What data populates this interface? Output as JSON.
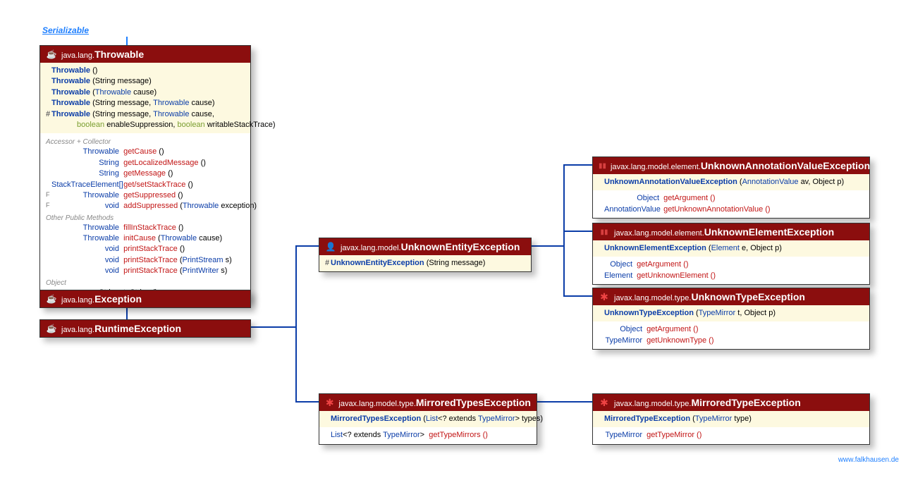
{
  "serializable": "Serializable",
  "watermark": "www.falkhausen.de",
  "throwable": {
    "pkg": "java.lang.",
    "name": "Throwable",
    "ctors": [
      {
        "marker": "",
        "sig": "Throwable ()"
      },
      {
        "marker": "",
        "sig": "Throwable (String message)"
      },
      {
        "marker": "",
        "sig": "Throwable (Throwable cause)"
      },
      {
        "marker": "",
        "sig": "Throwable (String message, Throwable cause)"
      },
      {
        "marker": "#",
        "sig": "Throwable (String message, Throwable cause,"
      },
      {
        "marker": "",
        "sig2": "boolean enableSuppression, boolean writableStackTrace)"
      }
    ],
    "sec1": "Accessor + Collector",
    "acc": [
      {
        "r": "Throwable",
        "m": "getCause ()"
      },
      {
        "r": "String",
        "m": "getLocalizedMessage ()"
      },
      {
        "r": "String",
        "m": "getMessage ()"
      },
      {
        "r": "StackTraceElement[]",
        "m": "get/setStackTrace ()"
      },
      {
        "r": "Throwable",
        "m": "getSuppressed ()",
        "f": "F"
      },
      {
        "r": "void",
        "m": "addSuppressed (Throwable exception)",
        "f": "F"
      }
    ],
    "sec2": "Other Public Methods",
    "other": [
      {
        "r": "Throwable",
        "m": "fillInStackTrace ()"
      },
      {
        "r": "Throwable",
        "m": "initCause (Throwable cause)"
      },
      {
        "r": "void",
        "m": "printStackTrace ()"
      },
      {
        "r": "void",
        "m": "printStackTrace (PrintStream s)"
      },
      {
        "r": "void",
        "m": "printStackTrace (PrintWriter s)"
      }
    ],
    "sec3": "Object",
    "obj": [
      {
        "r": "String",
        "m": "toString ()"
      }
    ]
  },
  "exception": {
    "pkg": "java.lang.",
    "name": "Exception"
  },
  "runtime": {
    "pkg": "java.lang.",
    "name": "RuntimeException"
  },
  "unknownEntity": {
    "pkg": "javax.lang.model.",
    "name": "UnknownEntityException",
    "ctor_marker": "#",
    "ctor": "UnknownEntityException (String message)"
  },
  "uave": {
    "pkg": "javax.lang.model.element.",
    "name": "UnknownAnnotationValueException",
    "ctor": "UnknownAnnotationValueException (AnnotationValue av, Object p)",
    "m1_r": "Object",
    "m1": "getArgument ()",
    "m2_r": "AnnotationValue",
    "m2": "getUnknownAnnotationValue ()"
  },
  "uee": {
    "pkg": "javax.lang.model.element.",
    "name": "UnknownElementException",
    "ctor": "UnknownElementException (Element e, Object p)",
    "m1_r": "Object",
    "m1": "getArgument ()",
    "m2_r": "Element",
    "m2": "getUnknownElement ()"
  },
  "ute": {
    "pkg": "javax.lang.model.type.",
    "name": "UnknownTypeException",
    "ctor": "UnknownTypeException (TypeMirror t, Object p)",
    "m1_r": "Object",
    "m1": "getArgument ()",
    "m2_r": "TypeMirror",
    "m2": "getUnknownType ()"
  },
  "mtes": {
    "pkg": "javax.lang.model.type.",
    "name": "MirroredTypesException",
    "ctor": "MirroredTypesException (List<? extends TypeMirror> types)",
    "m1_r": "List<? extends TypeMirror>",
    "m1": "getTypeMirrors ()"
  },
  "mte": {
    "pkg": "javax.lang.model.type.",
    "name": "MirroredTypeException",
    "ctor": "MirroredTypeException (TypeMirror type)",
    "m1_r": "TypeMirror",
    "m1": "getTypeMirror ()"
  }
}
